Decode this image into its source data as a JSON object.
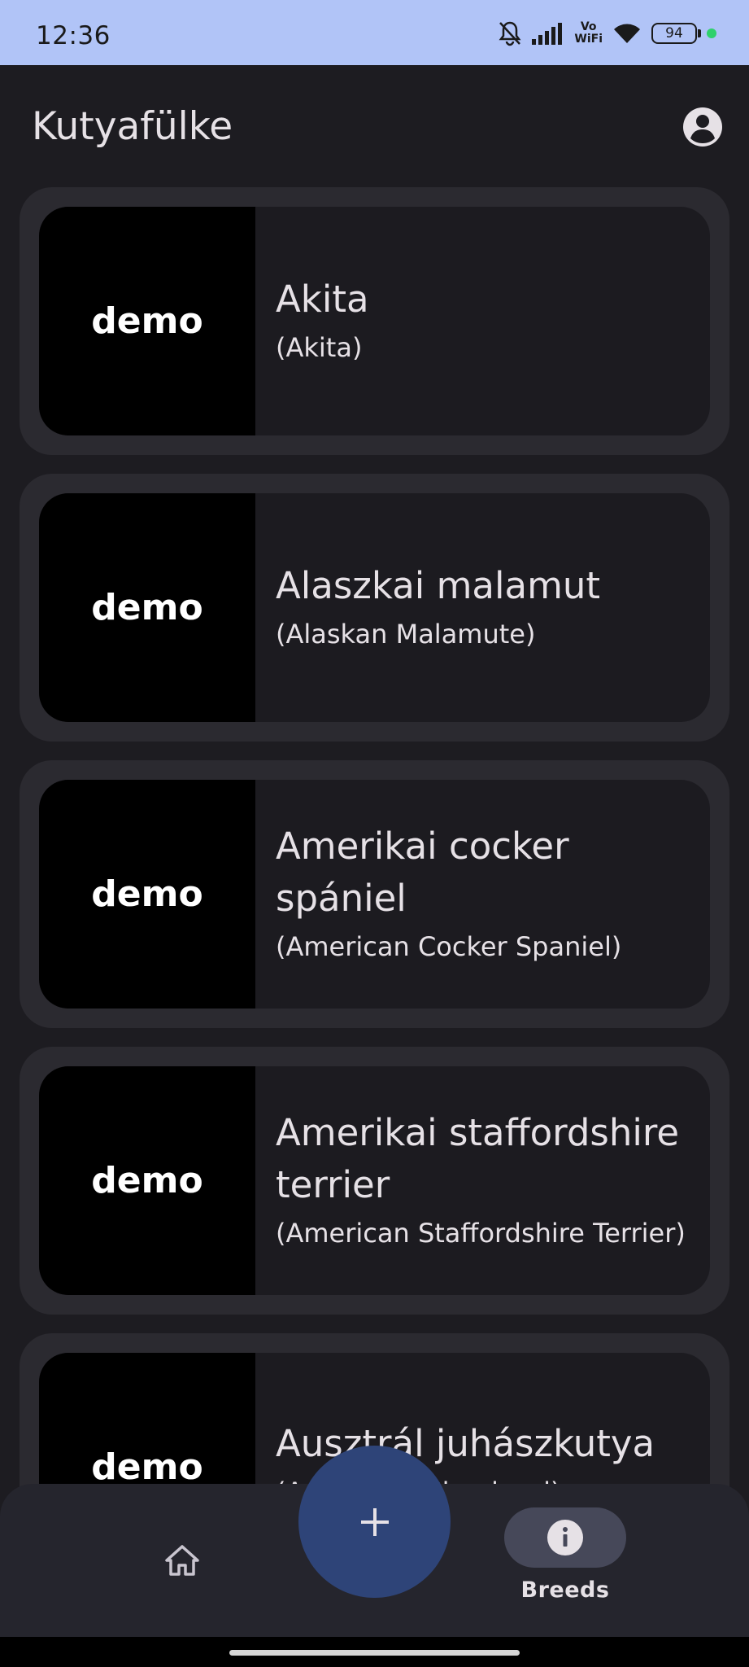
{
  "status_bar": {
    "time": "12:36",
    "vo_wifi_line1": "Vo",
    "vo_wifi_line2": "WiFi",
    "battery": "94"
  },
  "app_bar": {
    "title": "Kutyafülke",
    "account_icon": "account-circle-icon"
  },
  "breeds": [
    {
      "name": "Akita",
      "english": "(Akita)",
      "thumb": "demo"
    },
    {
      "name": "Alaszkai malamut",
      "english": "(Alaskan Malamute)",
      "thumb": "demo"
    },
    {
      "name": "Amerikai cocker spániel",
      "english": "(American Cocker Spaniel)",
      "thumb": "demo"
    },
    {
      "name": "Amerikai staffordshire terrier",
      "english": "(American Staffordshire Terrier)",
      "thumb": "demo"
    },
    {
      "name": "Ausztrál juhászkutya",
      "english": "(Australian Shepherd)",
      "thumb": "demo"
    }
  ],
  "bottom_nav": {
    "home_icon": "home-icon",
    "fab_icon": "plus-icon",
    "breeds_icon": "info-icon",
    "breeds_label": "Breeds"
  },
  "colors": {
    "status_bar": "#b1c4f7",
    "background": "#1d1c21",
    "card_outer": "#2b2a30",
    "card_inner": "#1c1b20",
    "fab": "#2e4478",
    "nav_pill": "#464859"
  }
}
